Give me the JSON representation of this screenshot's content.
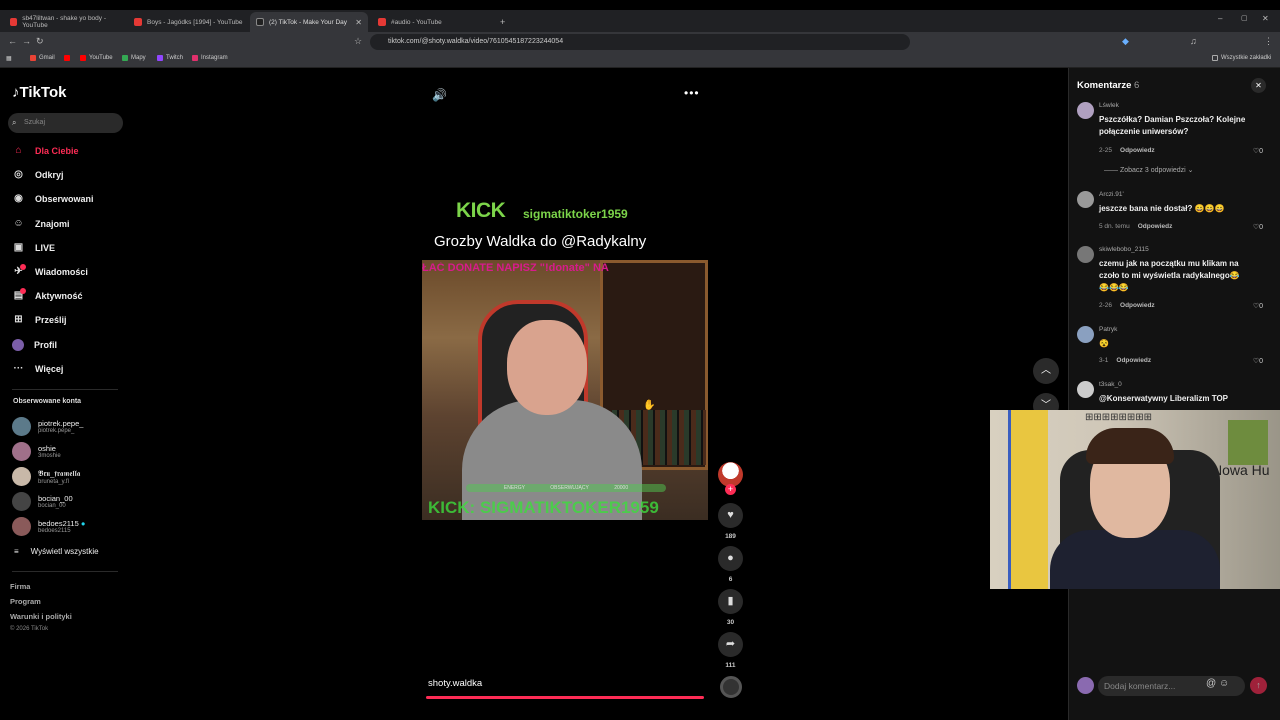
{
  "browser": {
    "tabs": [
      {
        "title": "sb47liltwan - shake yo body - YouTube",
        "active": false
      },
      {
        "title": "Boys - Jagódks [1994] - YouTube",
        "active": false
      },
      {
        "title": "(2) TikTok - Make Your Day",
        "active": true
      },
      {
        "title": "#audio - YouTube",
        "active": false
      }
    ],
    "url": "tiktok.com/@shoty.waldka/video/7610545187223244054",
    "bookmarks": [
      "Gmail",
      "YouTube",
      "Mapy",
      "Twitch",
      "Instagram"
    ],
    "all_bookmarks": "Wszystkie zakładki",
    "new_tab": "+"
  },
  "sidebar": {
    "logo": "TikTok",
    "search_placeholder": "Szukaj",
    "nav": [
      {
        "label": "Dla Ciebie",
        "icon": "home-icon",
        "active": true
      },
      {
        "label": "Odkryj",
        "icon": "compass-icon"
      },
      {
        "label": "Obserwowani",
        "icon": "following-icon"
      },
      {
        "label": "Znajomi",
        "icon": "friends-icon"
      },
      {
        "label": "LIVE",
        "icon": "live-icon"
      },
      {
        "label": "Wiadomości",
        "icon": "messages-icon"
      },
      {
        "label": "Aktywność",
        "icon": "activity-icon"
      },
      {
        "label": "Prześlij",
        "icon": "upload-icon"
      },
      {
        "label": "Profil",
        "icon": "profile-icon"
      },
      {
        "label": "Więcej",
        "icon": "more-icon"
      }
    ],
    "followed_title": "Obserwowane konta",
    "followed": [
      {
        "name": "piotrek.pepe_",
        "handle": "piotrek.pepe_"
      },
      {
        "name": "oshie",
        "handle": "3moshie"
      },
      {
        "name": "𝕭𝖗𝖚_𝖋𝖗𝖆𝖒𝖊𝖑𝖑𝖆",
        "handle": "bruneta_y.fl"
      },
      {
        "name": "bocian_00",
        "handle": "bocian_00"
      },
      {
        "name": "bedoes2115",
        "handle": "bedoes2115"
      }
    ],
    "show_all": "Wyświetl wszystkie",
    "footer": [
      "Firma",
      "Program",
      "Warunki i polityki"
    ],
    "copyright": "© 2026 TikTok"
  },
  "video": {
    "kick_logo": "KICK",
    "kick_user": "sigmatiktoker1959",
    "title": "Grozby Waldka do @Radykalny",
    "donate_text": "ŁAĆ DONATE NAPISZ \"!donate\" NA",
    "bar_left": "ENERGY",
    "bar_mid": "OBSERWUJĄCY",
    "bar_right": "20000",
    "kick_bottom": "KICK: SIGMATIKTOKER1959",
    "author": "shoty.waldka",
    "likes": "189",
    "comments": "6",
    "saves": "30",
    "shares": "111"
  },
  "comments": {
    "title": "Komentarze",
    "count": "6",
    "items": [
      {
        "user": "Lśwlek",
        "text": "Pszczółka? Damian Pszczoła? Kolejne połączenie uniwersów?",
        "date": "2-25",
        "reply": "Odpowiedz",
        "likes": "0"
      },
      {
        "user": "Arczi.91'",
        "text": "jeszcze bana nie dostał? 😄😄😄",
        "date": "5 dn. temu",
        "reply": "Odpowiedz",
        "likes": "0"
      },
      {
        "user": "skiwlebobo_2115",
        "text": "czemu jak na początku mu klikam na czoło to mi wyświetla radykalnego😂😂😂😂",
        "date": "2-26",
        "reply": "Odpowiedz",
        "likes": "0"
      },
      {
        "user": "Patryk",
        "text": "😵",
        "date": "3-1",
        "reply": "Odpowiedz",
        "likes": "0"
      },
      {
        "user": "t3sak_0",
        "text": "@Konserwatywny Liberalizm TOP",
        "date": "",
        "reply": "",
        "likes": ""
      }
    ],
    "view_replies": "Zobacz 3 odpowiedzi",
    "input_placeholder": "Dodaj komentarz..."
  },
  "webcam": {
    "wall_text": "Nowa Hu"
  }
}
